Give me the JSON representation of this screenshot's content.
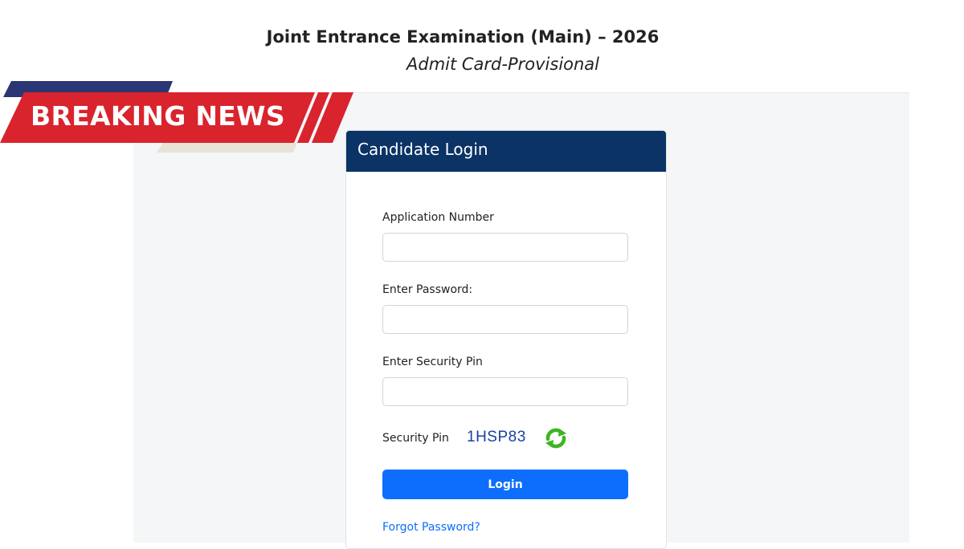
{
  "header": {
    "title": "Joint Entrance Examination (Main) – 2026",
    "subtitle": "Admit Card-Provisional"
  },
  "banner": {
    "text": "BREAKING NEWS",
    "colors": {
      "red": "#d9232d",
      "navy": "#2b3674",
      "beige": "#e9e2d6"
    }
  },
  "login": {
    "title": "Candidate Login",
    "fields": {
      "application_number": {
        "label": "Application Number",
        "value": "",
        "placeholder": ""
      },
      "password": {
        "label": "Enter Password:",
        "value": "",
        "placeholder": ""
      },
      "security_pin": {
        "label": "Enter Security Pin",
        "value": "",
        "placeholder": ""
      }
    },
    "captcha": {
      "label": "Security Pin",
      "code": "1HSP83",
      "refresh_icon": "refresh-icon"
    },
    "submit_label": "Login",
    "forgot_label": "Forgot Password?"
  },
  "colors": {
    "header_bg": "#0b3366",
    "primary": "#0d6efd",
    "captcha_text": "#1a3fa6",
    "refresh_icon": "#3cb521"
  }
}
